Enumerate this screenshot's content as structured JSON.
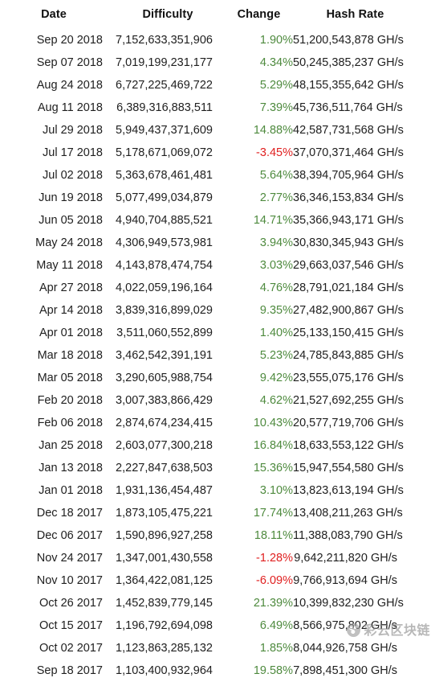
{
  "table": {
    "columns": [
      {
        "key": "date",
        "label": "Date"
      },
      {
        "key": "difficulty",
        "label": "Difficulty"
      },
      {
        "key": "change",
        "label": "Change"
      },
      {
        "key": "hash_rate",
        "label": "Hash Rate"
      }
    ],
    "rows": [
      {
        "date": "Sep 20 2018",
        "difficulty": "7,152,633,351,906",
        "change": "1.90%",
        "change_sign": "positive",
        "hash_rate": "51,200,543,878 GH/s"
      },
      {
        "date": "Sep 07 2018",
        "difficulty": "7,019,199,231,177",
        "change": "4.34%",
        "change_sign": "positive",
        "hash_rate": "50,245,385,237 GH/s"
      },
      {
        "date": "Aug 24 2018",
        "difficulty": "6,727,225,469,722",
        "change": "5.29%",
        "change_sign": "positive",
        "hash_rate": "48,155,355,642 GH/s"
      },
      {
        "date": "Aug 11 2018",
        "difficulty": "6,389,316,883,511",
        "change": "7.39%",
        "change_sign": "positive",
        "hash_rate": "45,736,511,764 GH/s"
      },
      {
        "date": "Jul 29 2018",
        "difficulty": "5,949,437,371,609",
        "change": "14.88%",
        "change_sign": "positive",
        "hash_rate": "42,587,731,568 GH/s"
      },
      {
        "date": "Jul 17 2018",
        "difficulty": "5,178,671,069,072",
        "change": "-3.45%",
        "change_sign": "negative",
        "hash_rate": "37,070,371,464 GH/s"
      },
      {
        "date": "Jul 02 2018",
        "difficulty": "5,363,678,461,481",
        "change": "5.64%",
        "change_sign": "positive",
        "hash_rate": "38,394,705,964 GH/s"
      },
      {
        "date": "Jun 19 2018",
        "difficulty": "5,077,499,034,879",
        "change": "2.77%",
        "change_sign": "positive",
        "hash_rate": "36,346,153,834 GH/s"
      },
      {
        "date": "Jun 05 2018",
        "difficulty": "4,940,704,885,521",
        "change": "14.71%",
        "change_sign": "positive",
        "hash_rate": "35,366,943,171 GH/s"
      },
      {
        "date": "May 24 2018",
        "difficulty": "4,306,949,573,981",
        "change": "3.94%",
        "change_sign": "positive",
        "hash_rate": "30,830,345,943 GH/s"
      },
      {
        "date": "May 11 2018",
        "difficulty": "4,143,878,474,754",
        "change": "3.03%",
        "change_sign": "positive",
        "hash_rate": "29,663,037,546 GH/s"
      },
      {
        "date": "Apr 27 2018",
        "difficulty": "4,022,059,196,164",
        "change": "4.76%",
        "change_sign": "positive",
        "hash_rate": "28,791,021,184 GH/s"
      },
      {
        "date": "Apr 14 2018",
        "difficulty": "3,839,316,899,029",
        "change": "9.35%",
        "change_sign": "positive",
        "hash_rate": "27,482,900,867 GH/s"
      },
      {
        "date": "Apr 01 2018",
        "difficulty": "3,511,060,552,899",
        "change": "1.40%",
        "change_sign": "positive",
        "hash_rate": "25,133,150,415 GH/s"
      },
      {
        "date": "Mar 18 2018",
        "difficulty": "3,462,542,391,191",
        "change": "5.23%",
        "change_sign": "positive",
        "hash_rate": "24,785,843,885 GH/s"
      },
      {
        "date": "Mar 05 2018",
        "difficulty": "3,290,605,988,754",
        "change": "9.42%",
        "change_sign": "positive",
        "hash_rate": "23,555,075,176 GH/s"
      },
      {
        "date": "Feb 20 2018",
        "difficulty": "3,007,383,866,429",
        "change": "4.62%",
        "change_sign": "positive",
        "hash_rate": "21,527,692,255 GH/s"
      },
      {
        "date": "Feb 06 2018",
        "difficulty": "2,874,674,234,415",
        "change": "10.43%",
        "change_sign": "positive",
        "hash_rate": "20,577,719,706 GH/s"
      },
      {
        "date": "Jan 25 2018",
        "difficulty": "2,603,077,300,218",
        "change": "16.84%",
        "change_sign": "positive",
        "hash_rate": "18,633,553,122 GH/s"
      },
      {
        "date": "Jan 13 2018",
        "difficulty": "2,227,847,638,503",
        "change": "15.36%",
        "change_sign": "positive",
        "hash_rate": "15,947,554,580 GH/s"
      },
      {
        "date": "Jan 01 2018",
        "difficulty": "1,931,136,454,487",
        "change": "3.10%",
        "change_sign": "positive",
        "hash_rate": "13,823,613,194 GH/s"
      },
      {
        "date": "Dec 18 2017",
        "difficulty": "1,873,105,475,221",
        "change": "17.74%",
        "change_sign": "positive",
        "hash_rate": "13,408,211,263 GH/s"
      },
      {
        "date": "Dec 06 2017",
        "difficulty": "1,590,896,927,258",
        "change": "18.11%",
        "change_sign": "positive",
        "hash_rate": "11,388,083,790 GH/s"
      },
      {
        "date": "Nov 24 2017",
        "difficulty": "1,347,001,430,558",
        "change": "-1.28%",
        "change_sign": "negative",
        "hash_rate": "9,642,211,820 GH/s"
      },
      {
        "date": "Nov 10 2017",
        "difficulty": "1,364,422,081,125",
        "change": "-6.09%",
        "change_sign": "negative",
        "hash_rate": "9,766,913,694 GH/s"
      },
      {
        "date": "Oct 26 2017",
        "difficulty": "1,452,839,779,145",
        "change": "21.39%",
        "change_sign": "positive",
        "hash_rate": "10,399,832,230 GH/s"
      },
      {
        "date": "Oct 15 2017",
        "difficulty": "1,196,792,694,098",
        "change": "6.49%",
        "change_sign": "positive",
        "hash_rate": "8,566,975,802 GH/s"
      },
      {
        "date": "Oct 02 2017",
        "difficulty": "1,123,863,285,132",
        "change": "1.85%",
        "change_sign": "positive",
        "hash_rate": "8,044,926,758 GH/s"
      },
      {
        "date": "Sep 18 2017",
        "difficulty": "1,103,400,932,964",
        "change": "19.58%",
        "change_sign": "positive",
        "hash_rate": "7,898,451,300 GH/s"
      }
    ]
  },
  "watermark": {
    "text": "彩云区块链"
  },
  "colors": {
    "positive": "#4e8a3e",
    "negative": "#e02020",
    "text": "#202020",
    "header_text": "#111111",
    "background": "#ffffff"
  }
}
